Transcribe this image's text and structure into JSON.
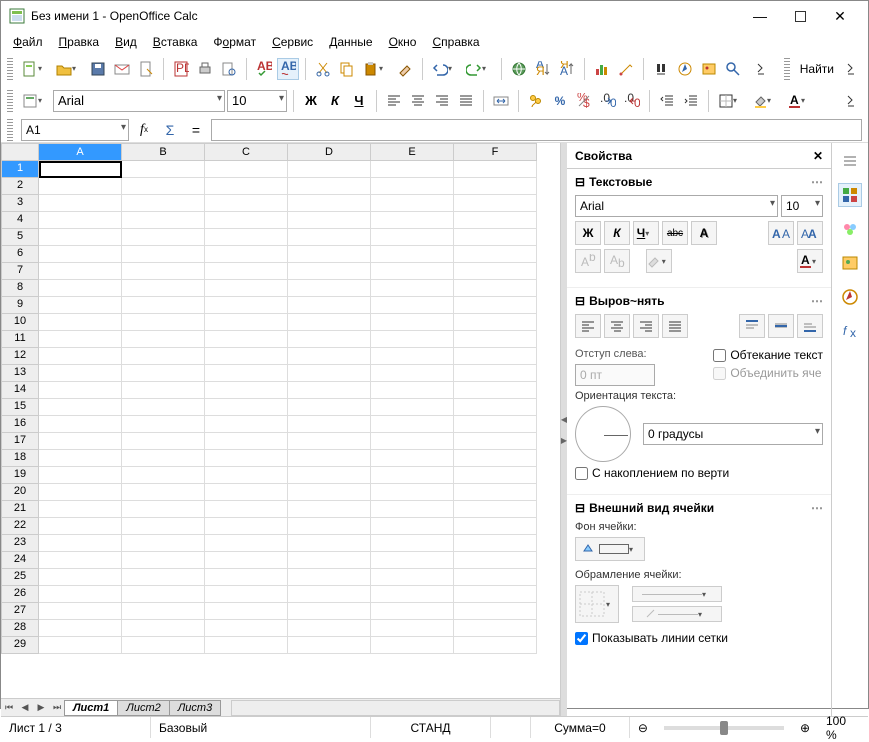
{
  "window": {
    "title": "Без имени 1 - OpenOffice Calc"
  },
  "menus": [
    "Файл",
    "Правка",
    "Вид",
    "Вставка",
    "Формат",
    "Сервис",
    "Данные",
    "Окно",
    "Справка"
  ],
  "toolbar2": {
    "font": "Arial",
    "size": "10",
    "find_label": "Найти"
  },
  "formula_bar": {
    "cell_ref": "A1",
    "eq": "="
  },
  "sheet": {
    "cols": [
      "A",
      "B",
      "C",
      "D",
      "E",
      "F"
    ],
    "rows": 29,
    "active_col": 0,
    "active_row": 0,
    "tabs": [
      "Лист1",
      "Лист2",
      "Лист3"
    ],
    "active_tab": 0
  },
  "sidebar": {
    "title": "Свойства",
    "text": {
      "title": "Текстовые",
      "font": "Arial",
      "size": "10",
      "bold": "Ж",
      "italic": "К",
      "underline": "Ч",
      "strike": "abc"
    },
    "align": {
      "title": "Выров~нять",
      "indent_label": "Отступ слева:",
      "indent_value": "0 пт",
      "wrap_label": "Обтекание текст",
      "merge_label": "Объединить яче",
      "orient_label": "Ориентация текста:",
      "angle_value": "0 градусы",
      "stack_label": "С накоплением по верти"
    },
    "appearance": {
      "title": "Внешний вид ячейки",
      "bg_label": "Фон ячейки:",
      "border_label": "Обрамление ячейки:",
      "grid_label": "Показывать линии сетки"
    }
  },
  "status": {
    "sheet_info": "Лист 1 / 3",
    "style": "Базовый",
    "mode": "СТАНД",
    "sum": "Сумма=0",
    "zoom": "100 %"
  }
}
